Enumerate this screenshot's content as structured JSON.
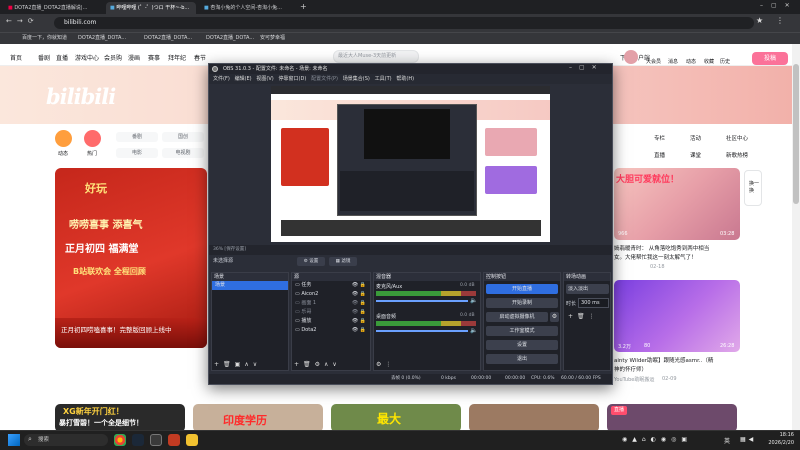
{
  "browser": {
    "tabs": [
      {
        "label": "DOTA2直播_DOTA2直播解说|..."
      },
      {
        "label": "哔哩哔哩 (゜-゜)つロ 干杯~-b..."
      },
      {
        "label": "杏淘小兔的个人空间-杏淘小兔..."
      }
    ],
    "url": "bilibili.com",
    "bookmarks": [
      "百度一下，你就知道",
      "DOTA2直播_DOTA...",
      "DOTA2直播_DOTA...",
      "DOTA2直播_DOTA...",
      "哔哩哔哩 (゜-゜)つロ...",
      "安可梦幸福"
    ]
  },
  "bili": {
    "nav": [
      "首页",
      "番剧",
      "直播",
      "游戏中心",
      "会员购",
      "漫画",
      "赛事",
      "拜年纪",
      "春节"
    ],
    "download": "下载客户端",
    "search_placeholder": "最近大人Muse-3天前更新",
    "right_nav": [
      "大会员",
      "消息",
      "动态",
      "收藏",
      "历史",
      "创作中心"
    ],
    "upload": "投稿",
    "logo": "bilibili",
    "left_icons": [
      "动态",
      "热门"
    ],
    "channels_row1": [
      "番剧",
      "国创",
      "综艺"
    ],
    "channels_row2": [
      "电影",
      "电视剧"
    ],
    "side_links": [
      "专栏",
      "活动",
      "社区中心",
      "直播",
      "课堂",
      "新歌热榜"
    ],
    "carousel_caption": "正月初四唠嗑喜事！完整版回顾上线中",
    "carousel_art": {
      "line1": "唠唠喜事 添喜气",
      "line2": "正月初四 福满堂",
      "line3": "B站联欢会 全程回顾",
      "badge": "好玩"
    },
    "cards": [
      {
        "views": "966",
        "dur": "03:28",
        "title": "嫣翡暖青时： 从角落吃饱秀到两中相当",
        "meta": "女。大佬帮忙我这一刻太解气了！",
        "date": "02-18",
        "art": "大胆可爱就位！"
      },
      {
        "views": "3.2万",
        "likes": "80",
        "dur": "26:28",
        "title": "ainty Wilder助眠】跟随光感asmr..（精",
        "meta": "神的怀疗师）",
        "author": "YouTube助眠搬运",
        "date": "02-09"
      }
    ],
    "live_badge": "直播",
    "bottom_art": [
      "XG新年开门红！",
      "暴打雪碧！一个全是细节！",
      "印度学历",
      "最大"
    ],
    "feedback": "换一换"
  },
  "obs": {
    "title": "OBS 31.0.3 - 配置文件: 未命名 - 场景: 未命名",
    "menu": [
      "文件(F)",
      "编辑(E)",
      "视图(V)",
      "停靠窗口(D)",
      "配置文件(P)",
      "场景集合(S)",
      "工具(T)",
      "帮助(H)"
    ],
    "preview_info": "36%   [保存设置]",
    "scene_label": "未选择源",
    "settings_btn": "设置",
    "filter_btn": "滤镜",
    "docks": {
      "scenes": {
        "title": "场景",
        "items": [
          "场景"
        ]
      },
      "sources": {
        "title": "源",
        "items": [
          "任务",
          "Aicon2",
          "画面 1",
          "乐哥",
          "播放",
          "Dota2"
        ]
      },
      "mixer": {
        "title": "混音器",
        "channels": [
          {
            "name": "麦克风/Aux",
            "db": "0.0 dB"
          },
          {
            "name": "桌面音频",
            "db": "0.0 dB"
          }
        ]
      },
      "controls": {
        "title": "控制按钮",
        "buttons": [
          "开始直播",
          "开始录制",
          "启动虚拟摄像机",
          "工作室模式",
          "设置",
          "退出"
        ]
      },
      "transitions": {
        "title": "转场动画",
        "type": "淡入淡出",
        "duration_label": "时长",
        "duration": "300 ms"
      }
    },
    "status": {
      "frames": "丢帧 0 (0.0%)",
      "bitrate": "0 kbps",
      "stream_time": "00:00:00",
      "rec_time": "00:00:00",
      "cpu": "CPU: 0.6%",
      "fps": "60.00 / 60.00 FPS"
    }
  },
  "taskbar": {
    "search": "搜索",
    "lang": "英",
    "time": "18:16",
    "date": "2026/2/20"
  },
  "colors": {
    "bili_pink": "#fb7299",
    "obs_bg": "#2b2e38",
    "obs_accent": "#2f6ee0"
  }
}
